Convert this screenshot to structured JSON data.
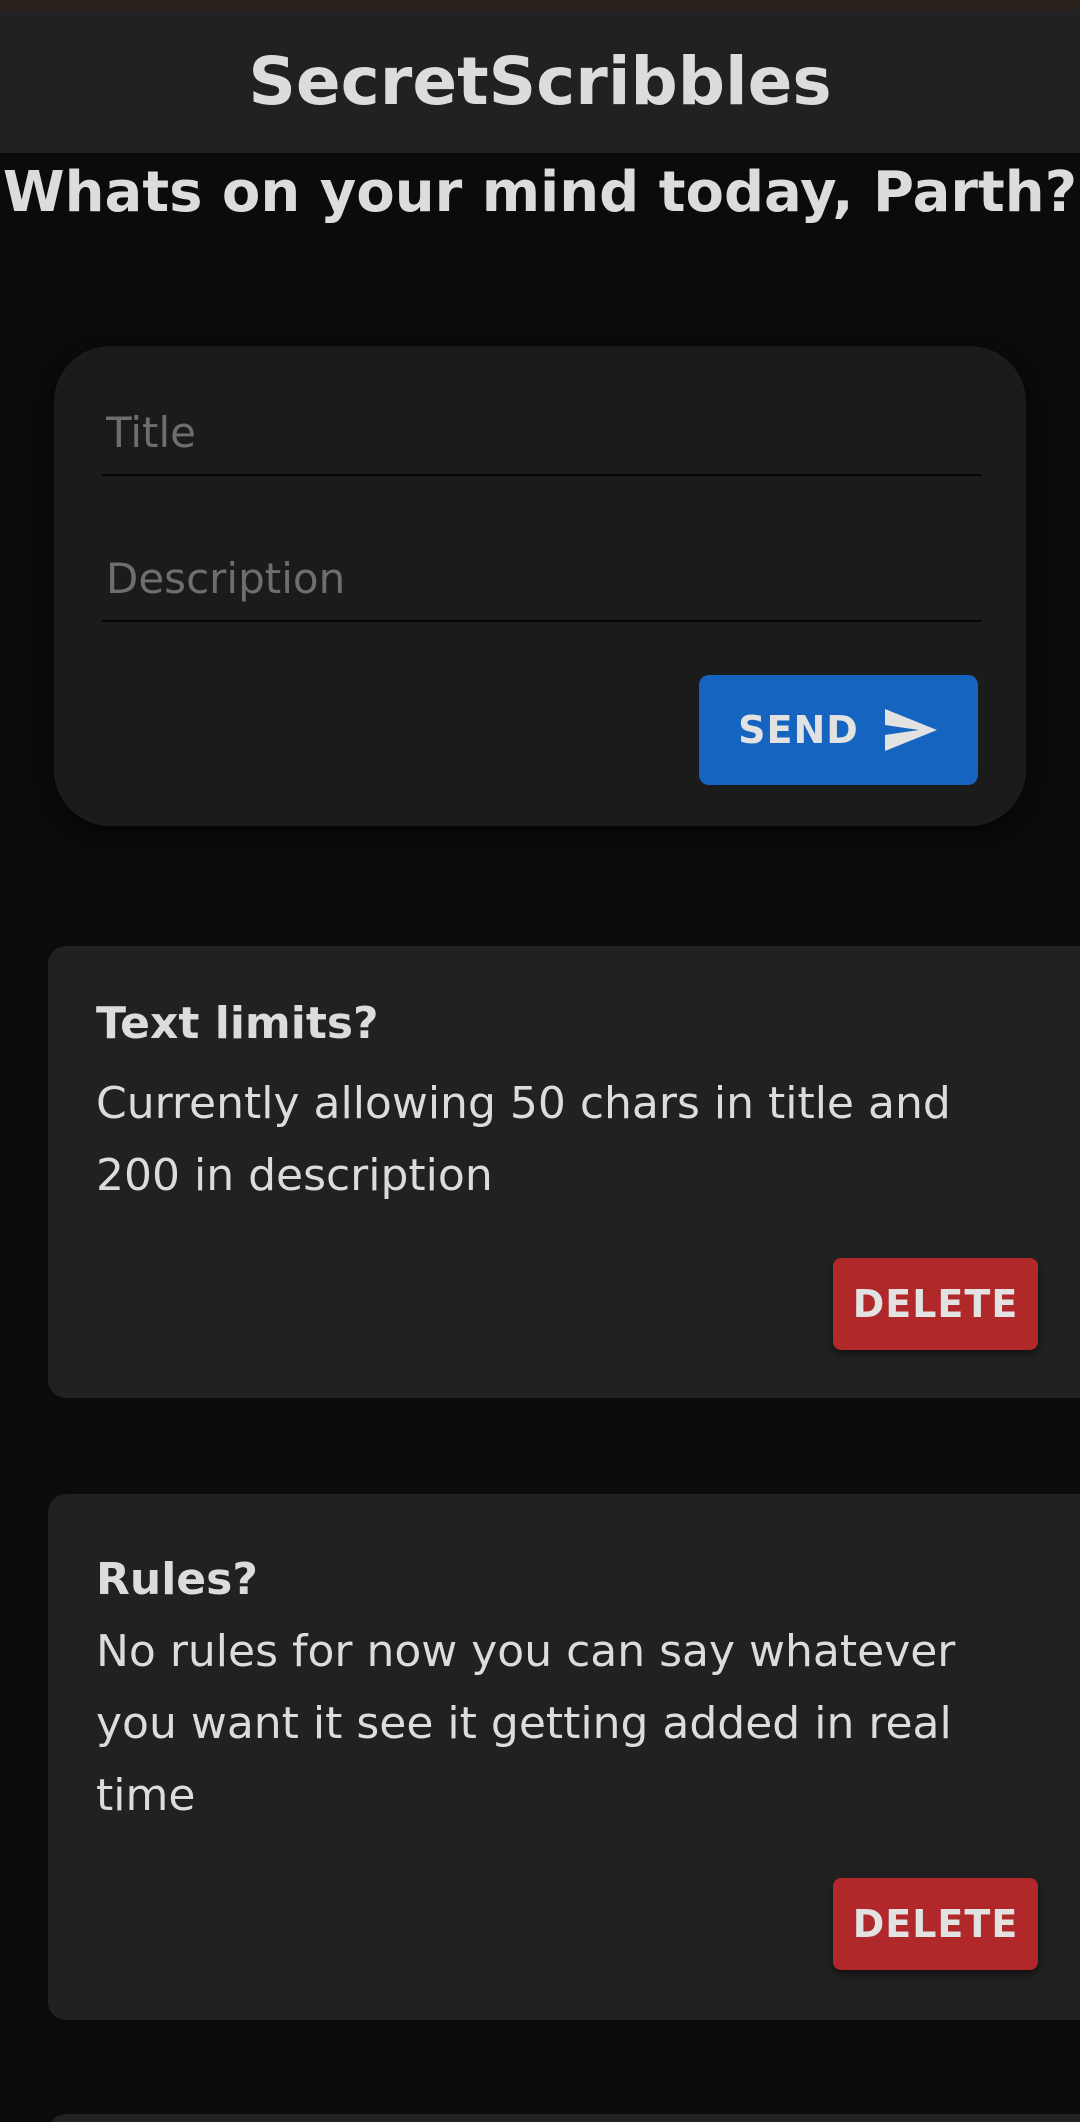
{
  "app": {
    "title": "SecretScribbles"
  },
  "greeting": "Whats on your mind today, Parth?",
  "composer": {
    "title_placeholder": "Title",
    "description_placeholder": "Description",
    "send_label": "SEND",
    "send_icon": "send-icon"
  },
  "colors": {
    "background": "#0b0b0b",
    "surface": "#212121",
    "send_button": "#1565c0",
    "delete_button": "#b0282a"
  },
  "posts": [
    {
      "title": "Text limits?",
      "description": "Currently allowing 50 chars in title and 200 in description",
      "delete_label": "DELETE"
    },
    {
      "title": "Rules?",
      "description": "No rules for now you can say whatever you want it see it getting added in real time",
      "delete_label": "DELETE"
    }
  ]
}
